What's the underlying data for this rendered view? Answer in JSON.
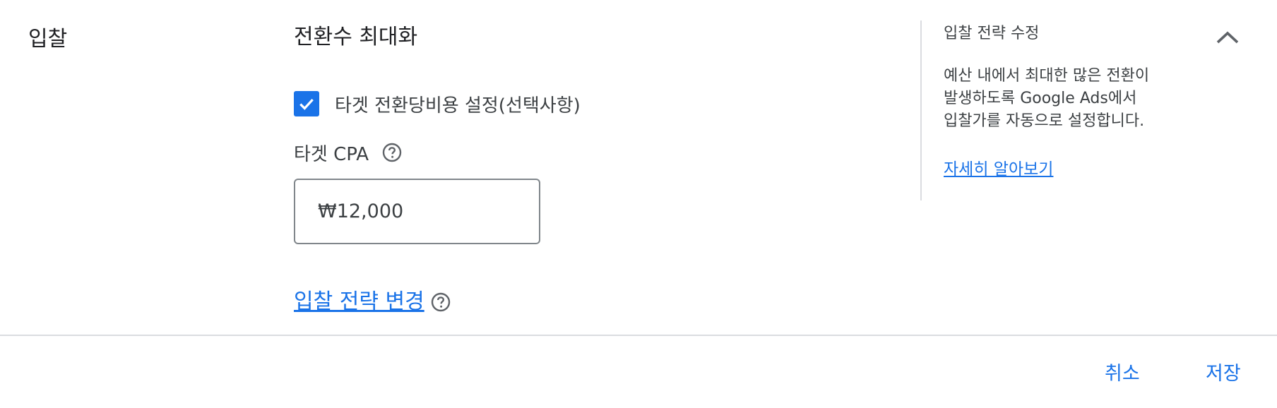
{
  "section": {
    "label": "입찰"
  },
  "strategy": {
    "title": "전환수 최대화",
    "target_cpa_checkbox": {
      "label": "타겟 전환당비용 설정(선택사항)",
      "checked": true
    },
    "target_cpa": {
      "label": "타겟 CPA",
      "value": "₩12,000",
      "help_icon": "help-circle-icon"
    },
    "change_link": "입찰 전략 변경"
  },
  "side_panel": {
    "title": "입찰 전략 수정",
    "description_lines": [
      "예산 내에서 최대한 많은 전환이",
      "발생하도록 Google Ads에서",
      "입찰가를 자동으로 설정합니다."
    ],
    "learn_more": "자세히 알아보기",
    "collapse_icon": "chevron-up-icon"
  },
  "footer": {
    "cancel": "취소",
    "save": "저장"
  },
  "colors": {
    "accent": "#1a73e8",
    "text": "#202124",
    "secondary_text": "#3c4043",
    "divider": "#dadce0",
    "icon": "#5f6368"
  }
}
